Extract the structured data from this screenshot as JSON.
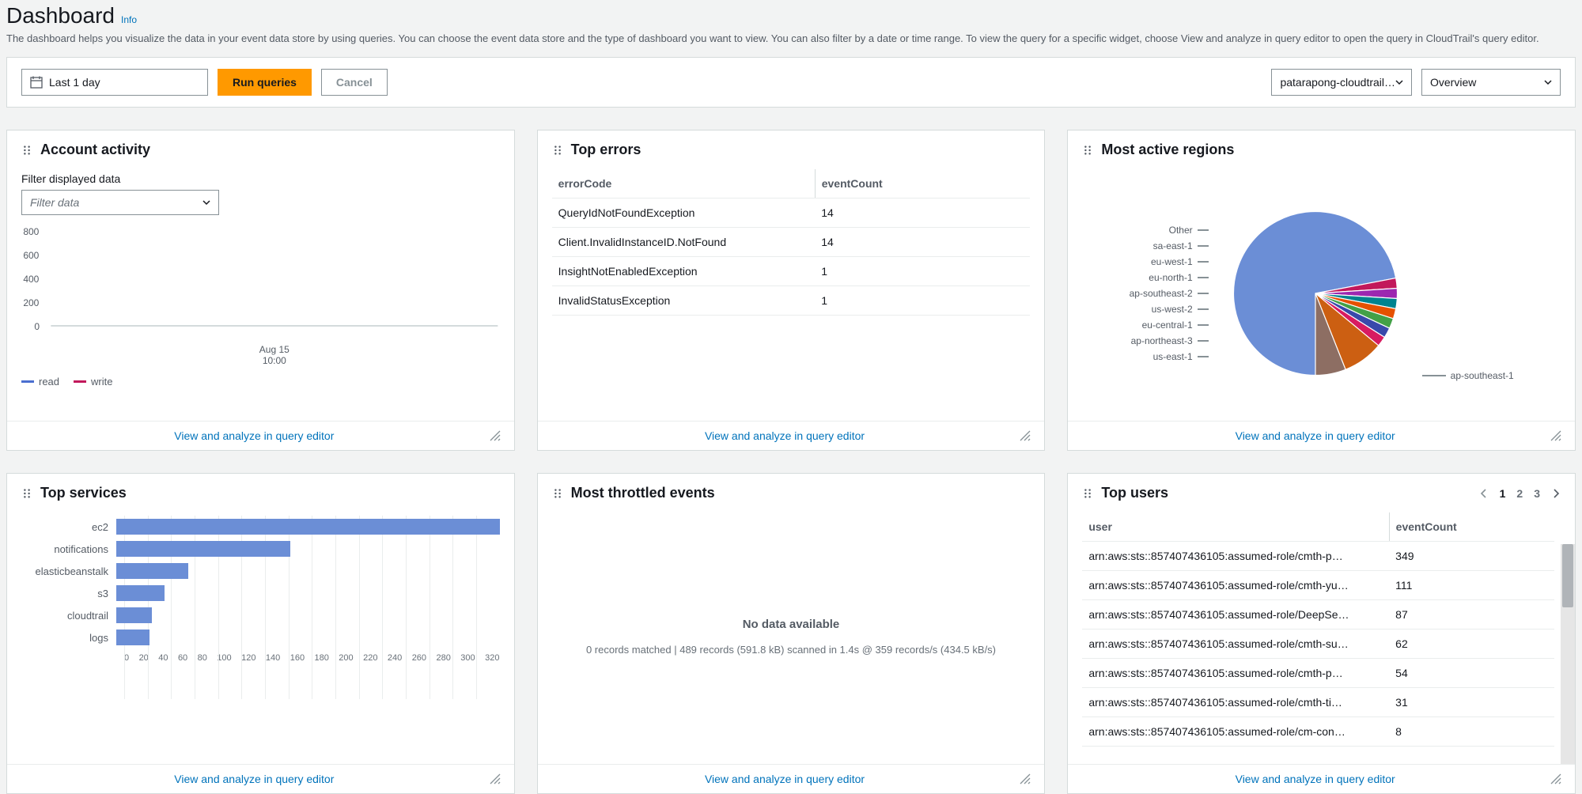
{
  "header": {
    "title": "Dashboard",
    "info": "Info",
    "description": "The dashboard helps you visualize the data in your event data store by using queries. You can choose the event data store and the type of dashboard you want to view. You can also filter by a date or time range. To view the query for a specific widget, choose View and analyze in query editor to open the query in CloudTrail's query editor."
  },
  "controls": {
    "time_range": "Last 1 day",
    "run_btn": "Run queries",
    "cancel_btn": "Cancel",
    "store_select": "patarapong-cloudtrail…",
    "dashboard_select": "Overview"
  },
  "widgets": {
    "account_activity": {
      "title": "Account activity",
      "filter_label": "Filter displayed data",
      "filter_placeholder": "Filter data",
      "xaxis_line1": "Aug 15",
      "xaxis_line2": "10:00",
      "legend_read": "read",
      "legend_write": "write",
      "link": "View and analyze in query editor"
    },
    "top_errors": {
      "title": "Top errors",
      "col1": "errorCode",
      "col2": "eventCount",
      "rows": [
        {
          "c1": "QueryIdNotFoundException",
          "c2": "14"
        },
        {
          "c1": "Client.InvalidInstanceID.NotFound",
          "c2": "14"
        },
        {
          "c1": "InsightNotEnabledException",
          "c2": "1"
        },
        {
          "c1": "InvalidStatusException",
          "c2": "1"
        }
      ],
      "link": "View and analyze in query editor"
    },
    "active_regions": {
      "title": "Most active regions",
      "legend": [
        "Other",
        "sa-east-1",
        "eu-west-1",
        "eu-north-1",
        "ap-southeast-2",
        "us-west-2",
        "eu-central-1",
        "ap-northeast-3",
        "us-east-1"
      ],
      "callout": "ap-southeast-1",
      "link": "View and analyze in query editor"
    },
    "top_services": {
      "title": "Top services",
      "max": 320,
      "bars": [
        {
          "label": "ec2",
          "value": 320
        },
        {
          "label": "notifications",
          "value": 145
        },
        {
          "label": "elasticbeanstalk",
          "value": 60
        },
        {
          "label": "s3",
          "value": 40
        },
        {
          "label": "cloudtrail",
          "value": 30
        },
        {
          "label": "logs",
          "value": 28
        }
      ],
      "xticks": [
        "0",
        "20",
        "40",
        "60",
        "80",
        "100",
        "120",
        "140",
        "160",
        "180",
        "200",
        "220",
        "240",
        "260",
        "280",
        "300",
        "320"
      ],
      "link": "View and analyze in query editor"
    },
    "throttled": {
      "title": "Most throttled events",
      "nodata_title": "No data available",
      "nodata_sub": "0 records matched | 489 records (591.8 kB) scanned in 1.4s @ 359 records/s (434.5 kB/s)",
      "link": "View and analyze in query editor"
    },
    "top_users": {
      "title": "Top users",
      "pages": [
        "1",
        "2",
        "3"
      ],
      "col1": "user",
      "col2": "eventCount",
      "rows": [
        {
          "c1": "arn:aws:sts::857407436105:assumed-role/cmth-p…",
          "c2": "349"
        },
        {
          "c1": "arn:aws:sts::857407436105:assumed-role/cmth-yu…",
          "c2": "111"
        },
        {
          "c1": "arn:aws:sts::857407436105:assumed-role/DeepSe…",
          "c2": "87"
        },
        {
          "c1": "arn:aws:sts::857407436105:assumed-role/cmth-su…",
          "c2": "62"
        },
        {
          "c1": "arn:aws:sts::857407436105:assumed-role/cmth-p…",
          "c2": "54"
        },
        {
          "c1": "arn:aws:sts::857407436105:assumed-role/cmth-ti…",
          "c2": "31"
        },
        {
          "c1": "arn:aws:sts::857407436105:assumed-role/cm-con…",
          "c2": "8"
        }
      ],
      "link": "View and analyze in query editor"
    }
  },
  "chart_data": [
    {
      "id": "account_activity",
      "type": "line",
      "series": [
        {
          "name": "read",
          "values": []
        },
        {
          "name": "write",
          "values": []
        }
      ],
      "x_ticks": [
        "Aug 15 10:00"
      ],
      "ylim": [
        0,
        800
      ],
      "y_ticks": [
        0,
        200,
        400,
        600,
        800
      ]
    },
    {
      "id": "active_regions",
      "type": "pie",
      "slices": [
        {
          "label": "ap-southeast-1",
          "value": 72
        },
        {
          "label": "us-east-1",
          "value": 2
        },
        {
          "label": "ap-northeast-3",
          "value": 2
        },
        {
          "label": "eu-central-1",
          "value": 2
        },
        {
          "label": "us-west-2",
          "value": 2
        },
        {
          "label": "ap-southeast-2",
          "value": 2
        },
        {
          "label": "eu-north-1",
          "value": 2
        },
        {
          "label": "eu-west-1",
          "value": 2
        },
        {
          "label": "sa-east-1",
          "value": 8
        },
        {
          "label": "Other",
          "value": 6
        }
      ]
    },
    {
      "id": "top_services",
      "type": "bar",
      "orientation": "horizontal",
      "categories": [
        "ec2",
        "notifications",
        "elasticbeanstalk",
        "s3",
        "cloudtrail",
        "logs"
      ],
      "values": [
        320,
        145,
        60,
        40,
        30,
        28
      ],
      "xlim": [
        0,
        320
      ]
    }
  ]
}
